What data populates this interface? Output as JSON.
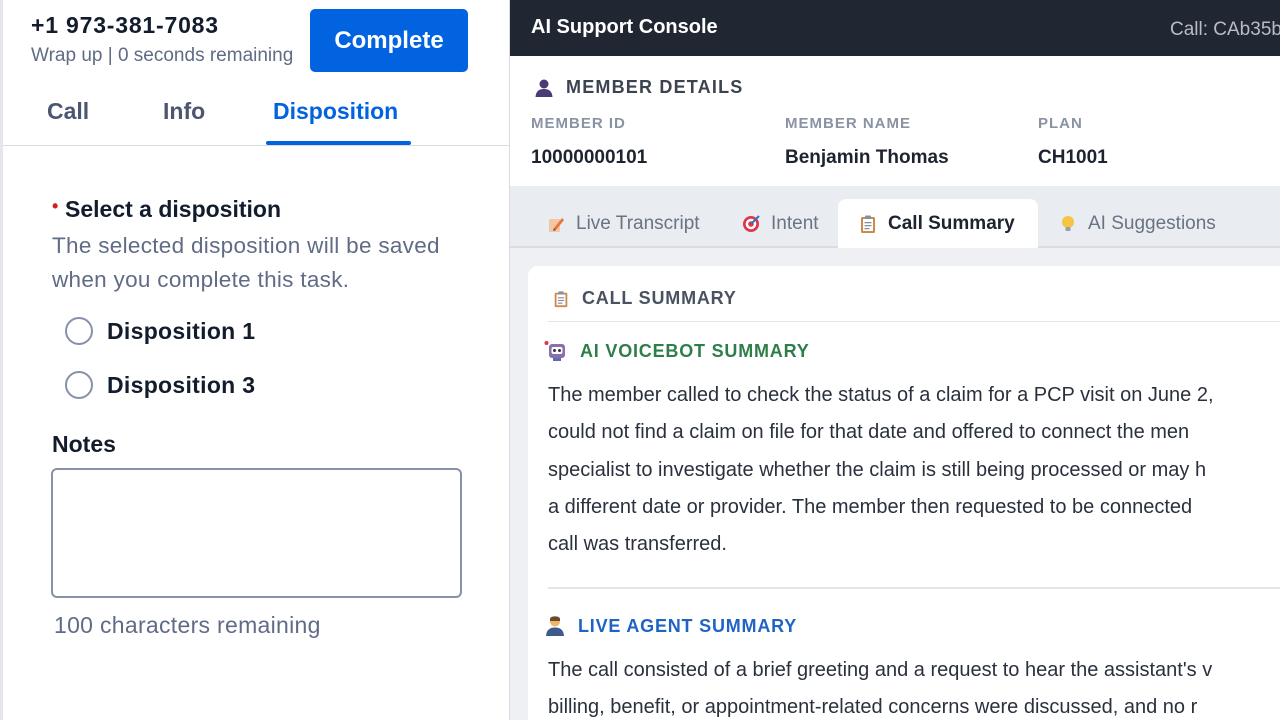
{
  "task": {
    "phone": "+1 973-381-7083",
    "status": "Wrap up | 0 seconds remaining",
    "complete_label": "Complete",
    "tabs": [
      {
        "label": "Call"
      },
      {
        "label": "Info"
      },
      {
        "label": "Disposition"
      }
    ],
    "disposition": {
      "required_marker": "•",
      "title": "Select a disposition",
      "help": "The selected disposition will be saved when you complete this task.",
      "options": [
        {
          "label": "Disposition 1"
        },
        {
          "label": "Disposition 3"
        }
      ]
    },
    "notes": {
      "label": "Notes",
      "value": "",
      "counter": "100 characters remaining"
    },
    "accent_color": "#0263e0"
  },
  "console": {
    "title": "AI Support Console",
    "call_id": "Call: CAb35b",
    "member": {
      "section_title": "MEMBER DETAILS",
      "fields": [
        {
          "label": "MEMBER ID",
          "value": "10000000101"
        },
        {
          "label": "MEMBER NAME",
          "value": "Benjamin Thomas"
        },
        {
          "label": "PLAN",
          "value": "CH1001"
        }
      ]
    },
    "tabs": [
      {
        "label": "Live Transcript",
        "icon": "pencil-icon"
      },
      {
        "label": "Intent",
        "icon": "target-icon"
      },
      {
        "label": "Call Summary",
        "icon": "clipboard-icon"
      },
      {
        "label": "AI Suggestions",
        "icon": "lightbulb-icon"
      }
    ],
    "active_tab": "Call Summary",
    "summary": {
      "title": "CALL SUMMARY",
      "voicebot": {
        "title": "AI VOICEBOT SUMMARY",
        "lines": [
          "The member called to check the status of a claim for a PCP visit on June 2,",
          "could not find a claim on file for that date and offered to connect the men",
          "specialist to investigate whether the claim is still being processed or may h",
          "a different date or provider. The member then requested to be connected",
          "call was transferred."
        ]
      },
      "agent": {
        "title": "LIVE AGENT SUMMARY",
        "lines": [
          "The call consisted of a brief greeting and a request to hear the assistant's v",
          "billing, benefit, or appointment-related concerns were discussed, and no r"
        ]
      }
    },
    "colors": {
      "topbar": "#202733",
      "voicebot_title": "#2e7d4a",
      "agent_title": "#1f63c4"
    }
  }
}
